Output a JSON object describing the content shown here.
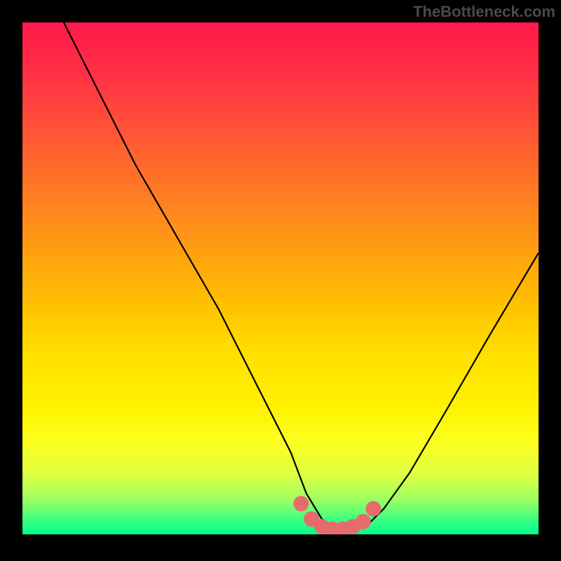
{
  "watermark": "TheBottleneck.com",
  "chart_data": {
    "type": "line",
    "title": "",
    "xlabel": "",
    "ylabel": "",
    "xlim": [
      0,
      100
    ],
    "ylim": [
      0,
      100
    ],
    "series": [
      {
        "name": "bottleneck-curve",
        "x": [
          8,
          15,
          22,
          30,
          38,
          45,
          52,
          55,
          58,
          61,
          64,
          67,
          70,
          75,
          82,
          90,
          100
        ],
        "y": [
          100,
          86,
          72,
          58,
          44,
          30,
          16,
          8,
          3,
          1,
          1,
          2,
          5,
          12,
          24,
          38,
          55
        ]
      }
    ],
    "highlights": {
      "name": "highlight-dots",
      "x": [
        54,
        56,
        58,
        60,
        62,
        64,
        66,
        68
      ],
      "y": [
        6,
        3,
        1.5,
        1,
        1,
        1.5,
        2.5,
        5
      ]
    },
    "gradient_stops": [
      {
        "pos": 0,
        "color": "#ff1a4a"
      },
      {
        "pos": 50,
        "color": "#ffc000"
      },
      {
        "pos": 80,
        "color": "#fcff20"
      },
      {
        "pos": 100,
        "color": "#00ff90"
      }
    ]
  }
}
